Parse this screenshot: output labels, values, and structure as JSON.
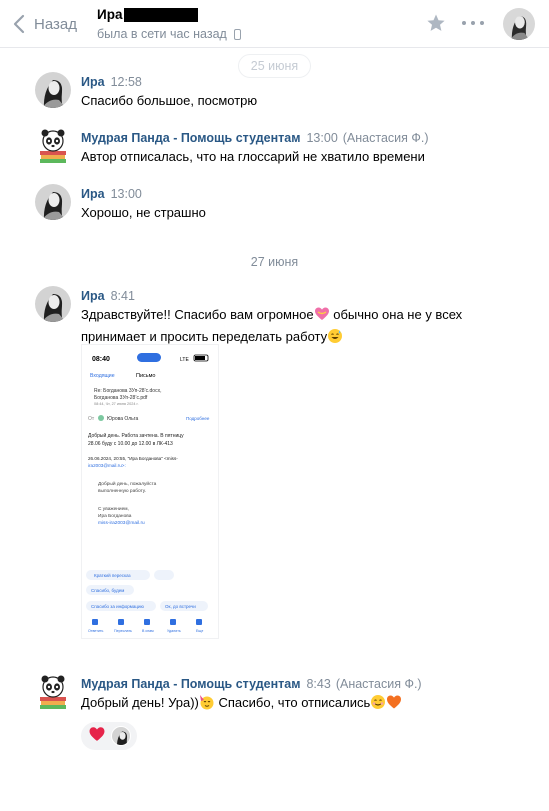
{
  "header": {
    "back_label": "Назад",
    "contact_name": "Ира",
    "status": "была в сети час назад"
  },
  "dates": {
    "first": "25 июня",
    "second": "27 июня"
  },
  "messages": [
    {
      "author": "Ира",
      "time": "12:58",
      "text": "Спасибо большое, посмотрю"
    },
    {
      "author": "Мудрая Панда - Помощь студентам",
      "time": "13:00",
      "extra": "(Анастасия Ф.)",
      "text": "Автор отписалась, что на глоссарий не хватило времени"
    },
    {
      "author": "Ира",
      "time": "13:00",
      "text": "Хорошо, не страшно"
    },
    {
      "author": "Ира",
      "time": "8:41",
      "line1": "Здравствуйте!! Спасибо вам огромное",
      "line1b": " обычно она не у всех",
      "line2": "принимает и просить переделать работу"
    },
    {
      "author": "Мудрая Панда - Помощь студентам",
      "time": "8:43",
      "extra": "(Анастасия Ф.)",
      "part1": "Добрый день! Ура))",
      "part2": " Спасибо, что отписались"
    }
  ],
  "attachment": {
    "phone_time": "08:40",
    "network": "LTE",
    "back": "Входящие",
    "title": "Письмо",
    "subject1": "Re: Богданова 3Уп-28’с.docx,",
    "subject2": "Богданова 3Уп-28’с.pdf",
    "subject_date": "08:44, Чт, 27 июня 2024 г.",
    "from_label": "От",
    "from_name": "Юрова Ольга",
    "details": "Подробнее",
    "body1": "Добрый день. Работа зачтена. В пятницу",
    "body2": "28.06 буду с 10.00 до 12.00 в ЛК-413",
    "quote1": "26.06.2024, 20:55, \"Ира Богданова\" <miss-",
    "quote2": "ira2003@mail.ru>:",
    "q_body1": "Добрый день, пожалуйста",
    "q_body2": "выполненную работу.",
    "sign1": "С уважением,",
    "sign2": "Ира Богданова",
    "sign3": "miss-ira2003@mail.ru",
    "reply1": "Краткий пересказ",
    "reply2": "Спасибо, будем",
    "reply3": "Спасибо за информацию",
    "reply4": "Ок, до встречи",
    "tabs": [
      "Ответить",
      "Переслать",
      "В спам",
      "Удалить",
      "Еще"
    ]
  },
  "colors": {
    "author": "#2a5885",
    "meta": "#818c99",
    "accent": "#2688eb"
  }
}
